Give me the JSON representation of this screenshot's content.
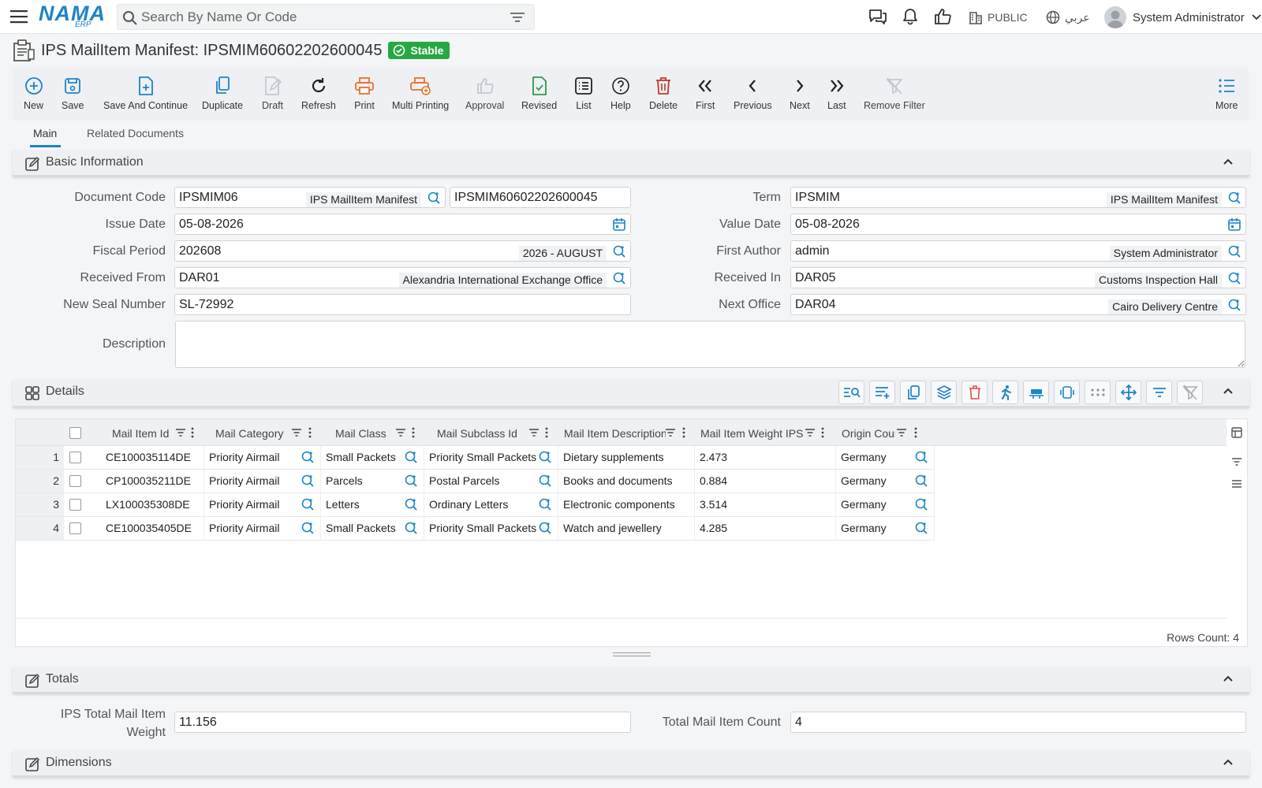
{
  "topbar": {
    "search_placeholder": "Search By Name Or Code",
    "company": "PUBLIC",
    "language": "عربي",
    "user": "System Administrator",
    "logo": "NAMA",
    "logo_sub": "ERP"
  },
  "title": {
    "text": "IPS MailItem Manifest: IPSMIM60602202600045",
    "status": "Stable"
  },
  "toolbar": {
    "new": "New",
    "save": "Save",
    "save_continue": "Save And Continue",
    "duplicate": "Duplicate",
    "draft": "Draft",
    "refresh": "Refresh",
    "print": "Print",
    "multi_printing": "Multi Printing",
    "approval": "Approval",
    "revised": "Revised",
    "list": "List",
    "help": "Help",
    "delete": "Delete",
    "first": "First",
    "previous": "Previous",
    "next": "Next",
    "last": "Last",
    "remove_filter": "Remove Filter",
    "more": "More"
  },
  "tabs": {
    "main": "Main",
    "related": "Related Documents"
  },
  "basic": {
    "section_title": "Basic Information",
    "document_code": {
      "label": "Document Code",
      "code": "IPSMIM06",
      "desc": "IPS MailItem Manifest",
      "number": "IPSMIM60602202600045"
    },
    "term": {
      "label": "Term",
      "code": "IPSMIM",
      "desc": "IPS MailItem Manifest"
    },
    "issue_date": {
      "label": "Issue Date",
      "value": "05-08-2026"
    },
    "value_date": {
      "label": "Value Date",
      "value": "05-08-2026"
    },
    "fiscal_period": {
      "label": "Fiscal Period",
      "code": "202608",
      "desc": "2026 - AUGUST"
    },
    "first_author": {
      "label": "First Author",
      "code": "admin",
      "desc": "System Administrator"
    },
    "received_from": {
      "label": "Received From",
      "code": "DAR01",
      "desc": "Alexandria International Exchange Office"
    },
    "received_in": {
      "label": "Received In",
      "code": "DAR05",
      "desc": "Customs Inspection Hall"
    },
    "new_seal": {
      "label": "New Seal Number",
      "value": "SL-72992"
    },
    "next_office": {
      "label": "Next Office",
      "code": "DAR04",
      "desc": "Cairo Delivery Centre"
    },
    "description": {
      "label": "Description",
      "value": ""
    }
  },
  "details": {
    "section_title": "Details",
    "columns": [
      "Mail Item Id",
      "Mail Category",
      "Mail Class",
      "Mail Subclass Id",
      "Mail Item Description",
      "Mail Item Weight IPS",
      "Origin Country"
    ],
    "rows": [
      {
        "num": "1",
        "id": "CE100035114DE",
        "category": "Priority Airmail",
        "class": "Small Packets",
        "subclass": "Priority Small Packets",
        "description": "Dietary supplements",
        "weight": "2.473",
        "origin": "Germany"
      },
      {
        "num": "2",
        "id": "CP100035211DE",
        "category": "Priority Airmail",
        "class": "Parcels",
        "subclass": "Postal Parcels",
        "description": "Books and documents",
        "weight": "0.884",
        "origin": "Germany"
      },
      {
        "num": "3",
        "id": "LX100035308DE",
        "category": "Priority Airmail",
        "class": "Letters",
        "subclass": "Ordinary Letters",
        "description": "Electronic components",
        "weight": "3.514",
        "origin": "Germany"
      },
      {
        "num": "4",
        "id": "CE100035405DE",
        "category": "Priority Airmail",
        "class": "Small Packets",
        "subclass": "Priority Small Packets",
        "description": "Watch and jewellery",
        "weight": "4.285",
        "origin": "Germany"
      }
    ],
    "rows_count": "Rows Count: 4"
  },
  "totals": {
    "section_title": "Totals",
    "total_weight": {
      "label_line1": "IPS Total Mail Item",
      "label_line2": "Weight",
      "value": "11.156"
    },
    "total_count": {
      "label": "Total Mail Item Count",
      "value": "4"
    }
  },
  "dimensions": {
    "section_title": "Dimensions"
  },
  "colors": {
    "accent": "#1c84c6",
    "stable": "#28a745",
    "print": "#e8712b",
    "delete": "#c0392b",
    "save_green": "#2e9a4a"
  }
}
